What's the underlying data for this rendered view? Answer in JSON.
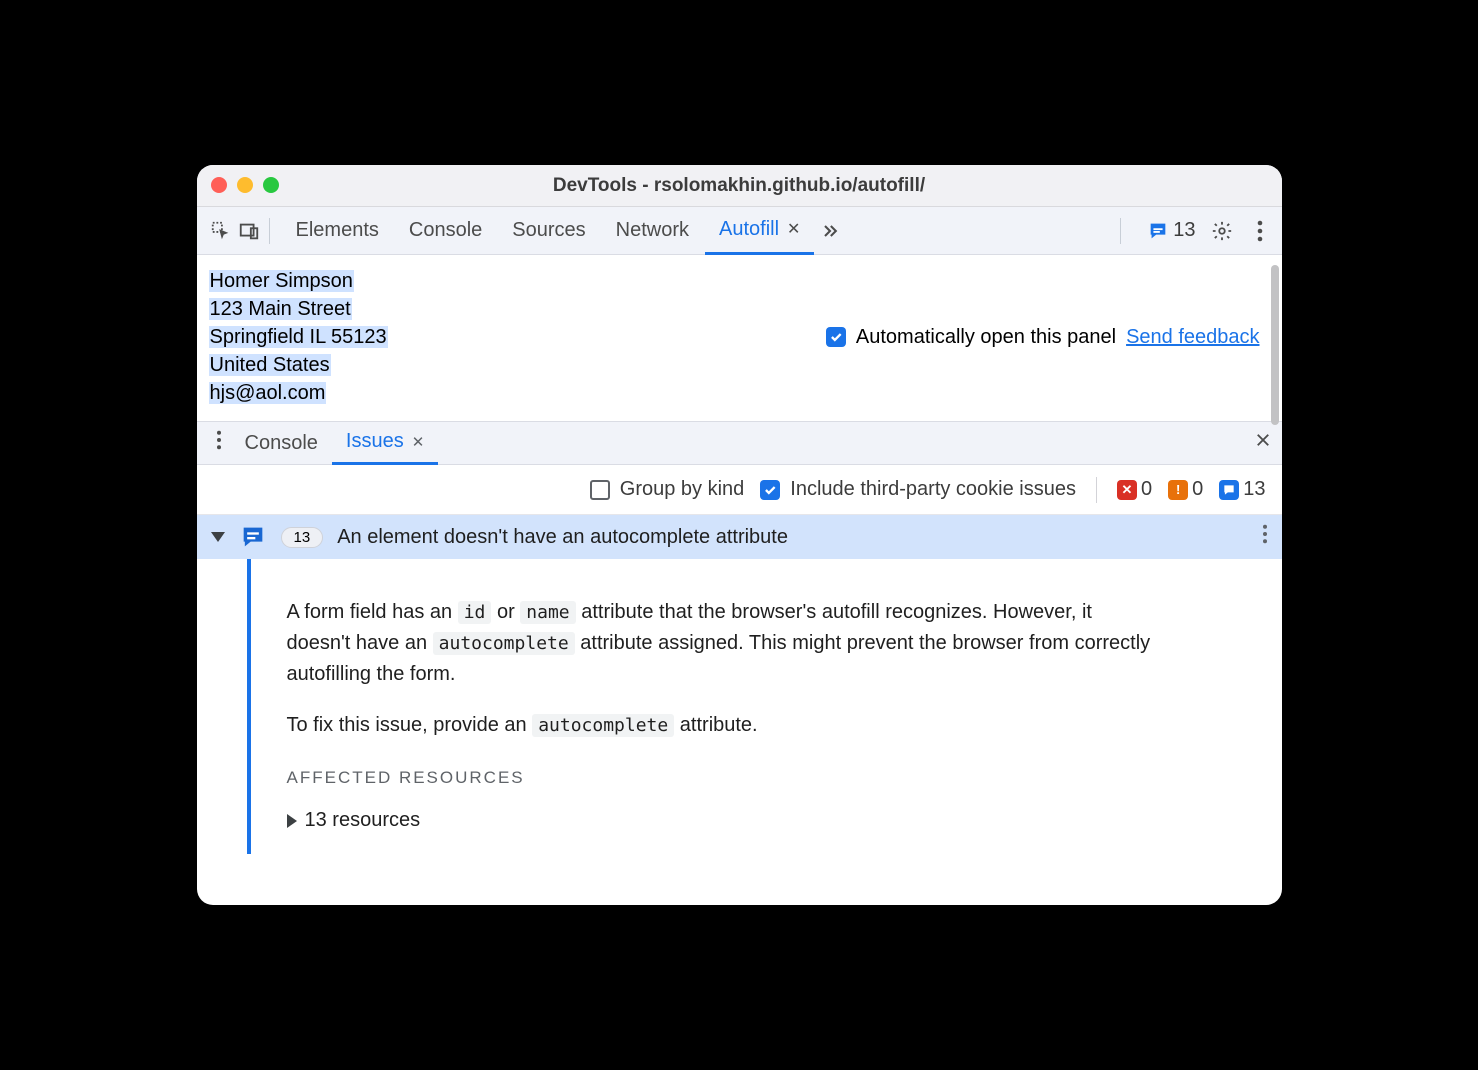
{
  "window": {
    "title": "DevTools - rsolomakhin.github.io/autofill/"
  },
  "toolbar": {
    "tabs": [
      {
        "label": "Elements"
      },
      {
        "label": "Console"
      },
      {
        "label": "Sources"
      },
      {
        "label": "Network"
      },
      {
        "label": "Autofill",
        "active": true,
        "closable": true
      }
    ],
    "messages_count": "13"
  },
  "autofill_preview": {
    "name": "Homer Simpson",
    "street": "123 Main Street",
    "city_line": "Springfield IL 55123",
    "country": "United States",
    "email": "hjs@aol.com"
  },
  "top_controls": {
    "auto_open_label": "Automatically open this panel",
    "auto_open_checked": true,
    "feedback_label": "Send feedback"
  },
  "drawer": {
    "tabs": [
      {
        "label": "Console"
      },
      {
        "label": "Issues",
        "active": true,
        "closable": true
      }
    ]
  },
  "issues_filter": {
    "group_by_kind_label": "Group by kind",
    "group_by_kind_checked": false,
    "third_party_label": "Include third-party cookie issues",
    "third_party_checked": true,
    "severities": {
      "error": "0",
      "warn": "0",
      "info": "13"
    }
  },
  "issue": {
    "count": "13",
    "title": "An element doesn't have an autocomplete attribute",
    "para1_pre": "A form field has an ",
    "code1": "id",
    "para1_mid": " or ",
    "code2": "name",
    "para1_post": " attribute that the browser's autofill recognizes. However, it doesn't have an ",
    "code3": "autocomplete",
    "para1_end": " attribute assigned. This might prevent the browser from correctly autofilling the form.",
    "para2_pre": "To fix this issue, provide an ",
    "code4": "autocomplete",
    "para2_post": " attribute.",
    "affected_heading": "AFFECTED RESOURCES",
    "resources_label": "13 resources"
  }
}
